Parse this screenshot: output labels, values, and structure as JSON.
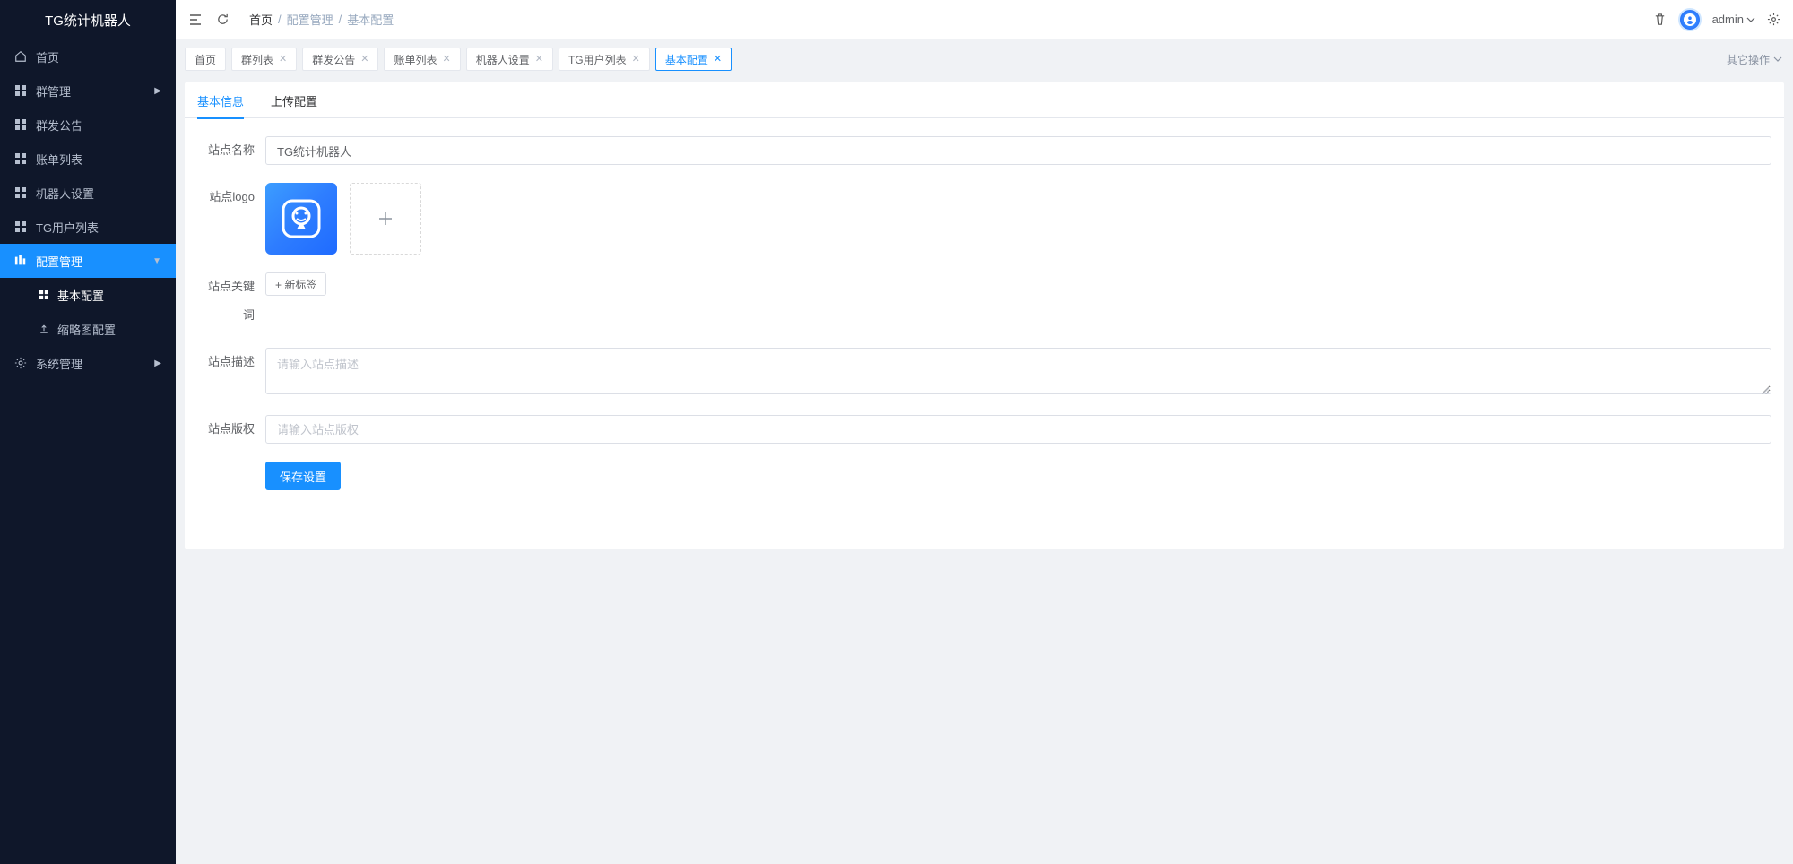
{
  "brand": "TG统计机器人",
  "sidebar": {
    "items": [
      {
        "icon": "home",
        "label": "首页",
        "active": false,
        "expandable": false
      },
      {
        "icon": "grid",
        "label": "群管理",
        "active": false,
        "expandable": true
      },
      {
        "icon": "grid",
        "label": "群发公告",
        "active": false,
        "expandable": false
      },
      {
        "icon": "grid",
        "label": "账单列表",
        "active": false,
        "expandable": false
      },
      {
        "icon": "grid",
        "label": "机器人设置",
        "active": false,
        "expandable": false
      },
      {
        "icon": "grid",
        "label": "TG用户列表",
        "active": false,
        "expandable": false
      },
      {
        "icon": "bars",
        "label": "配置管理",
        "active": true,
        "expandable": true,
        "open": true,
        "children": [
          {
            "icon": "grid",
            "label": "基本配置",
            "active": true
          },
          {
            "icon": "upload",
            "label": "缩略图配置",
            "active": false
          }
        ]
      },
      {
        "icon": "gear",
        "label": "系统管理",
        "active": false,
        "expandable": true
      }
    ]
  },
  "header": {
    "breadcrumb": [
      "首页",
      "配置管理",
      "基本配置"
    ],
    "user": "admin"
  },
  "tabs": {
    "items": [
      {
        "label": "首页",
        "closable": false,
        "active": false
      },
      {
        "label": "群列表",
        "closable": true,
        "active": false
      },
      {
        "label": "群发公告",
        "closable": true,
        "active": false
      },
      {
        "label": "账单列表",
        "closable": true,
        "active": false
      },
      {
        "label": "机器人设置",
        "closable": true,
        "active": false
      },
      {
        "label": "TG用户列表",
        "closable": true,
        "active": false
      },
      {
        "label": "基本配置",
        "closable": true,
        "active": true
      }
    ],
    "other_ops": "其它操作"
  },
  "inner_tabs": {
    "items": [
      {
        "label": "基本信息",
        "active": true
      },
      {
        "label": "上传配置",
        "active": false
      }
    ]
  },
  "form": {
    "site_name": {
      "label": "站点名称",
      "value": "TG统计机器人"
    },
    "site_logo": {
      "label": "站点logo"
    },
    "site_keywords": {
      "label": "站点关键词",
      "new_tag": "+ 新标签"
    },
    "site_desc": {
      "label": "站点描述",
      "placeholder": "请输入站点描述",
      "value": ""
    },
    "site_copyright": {
      "label": "站点版权",
      "placeholder": "请输入站点版权",
      "value": ""
    },
    "save_label": "保存设置"
  }
}
